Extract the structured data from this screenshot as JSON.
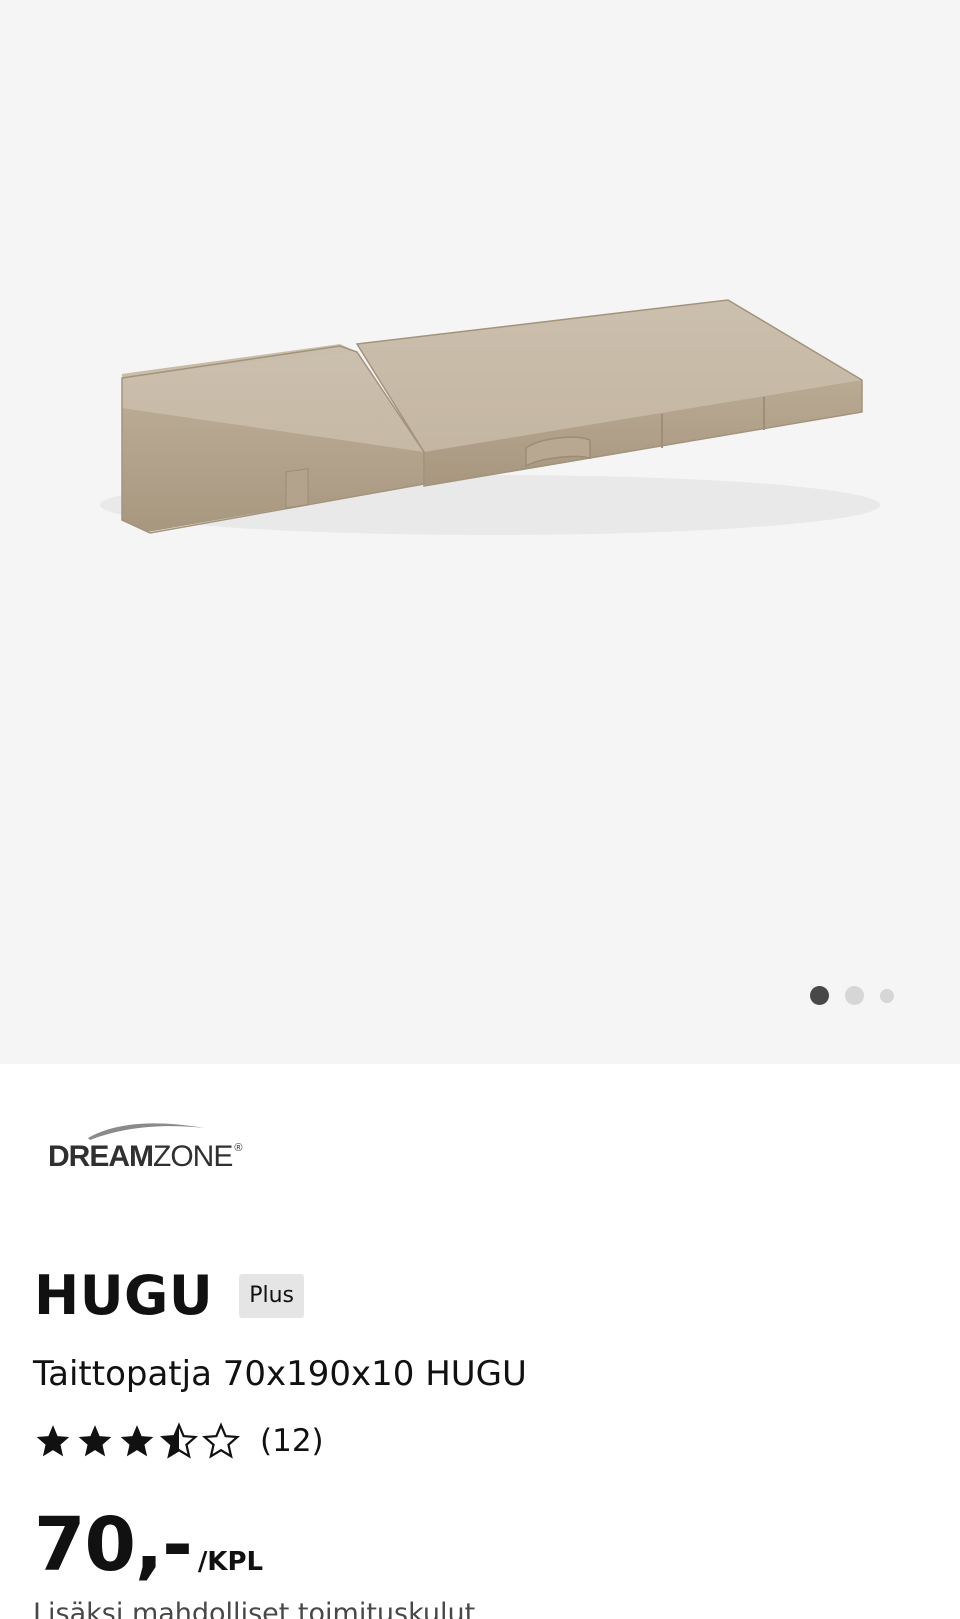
{
  "gallery": {
    "image_alt": "",
    "slide_count": 3,
    "active_slide": 1
  },
  "brand": {
    "name_bold": "DREAM",
    "name_light": "ZONE",
    "registered_mark": "®"
  },
  "product": {
    "name": "HUGU",
    "badge": "Plus",
    "description": "Taittopatja 70x190x10 HUGU",
    "rating": 3.5,
    "rating_max": 5,
    "review_count_label": "(12)",
    "price": "70,-",
    "price_unit": "/KPL",
    "shipping_note": "Lisäksi mahdolliset toimituskulut"
  },
  "colors": {
    "gallery_bg": "#f5f5f5",
    "mattress": "#c1b3a0",
    "text": "#111111",
    "badge_bg": "#e5e5e5",
    "dot_active": "#484848",
    "dot_inactive": "#d6d6d6"
  }
}
